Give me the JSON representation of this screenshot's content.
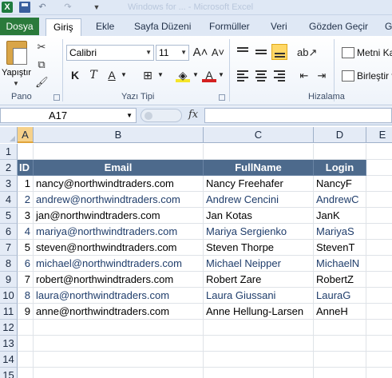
{
  "titlebar": {
    "app_icon": "X",
    "title_text": "Windows for ... - Microsoft Excel"
  },
  "tabs": [
    {
      "label": "Dosya",
      "kind": "file"
    },
    {
      "label": "Giriş",
      "kind": "active"
    },
    {
      "label": "Ekle"
    },
    {
      "label": "Sayfa Düzeni"
    },
    {
      "label": "Formüller"
    },
    {
      "label": "Veri"
    },
    {
      "label": "Gözden Geçir"
    },
    {
      "label": "G"
    }
  ],
  "ribbon": {
    "clipboard": {
      "paste_label": "Yapıştır",
      "group_label": "Pano"
    },
    "font": {
      "font_name": "Calibri",
      "font_size": "11",
      "bold": "K",
      "italic": "T",
      "underline": "A",
      "group_label": "Yazı Tipi"
    },
    "alignment": {
      "wrap_text": "Metni Ka",
      "merge": "Birleştir v",
      "group_label": "Hizalama"
    }
  },
  "formula_bar": {
    "name_box": "A17",
    "fx": "fx",
    "formula": ""
  },
  "sheet": {
    "columns": [
      "A",
      "B",
      "C",
      "D",
      "E"
    ],
    "selected_column": "A",
    "row_numbers": [
      "1",
      "2",
      "3",
      "4",
      "5",
      "6",
      "7",
      "8",
      "9",
      "10",
      "11",
      "12",
      "13",
      "14",
      "15"
    ],
    "header": [
      "ID",
      "Email",
      "FullName",
      "Login"
    ],
    "rows": [
      {
        "id": "1",
        "email": "nancy@northwindtraders.com",
        "fullname": "Nancy Freehafer",
        "login": "NancyF"
      },
      {
        "id": "2",
        "email": "andrew@northwindtraders.com",
        "fullname": "Andrew Cencini",
        "login": "AndrewC"
      },
      {
        "id": "3",
        "email": "jan@northwindtraders.com",
        "fullname": "Jan Kotas",
        "login": "JanK"
      },
      {
        "id": "4",
        "email": "mariya@northwindtraders.com",
        "fullname": "Mariya Sergienko",
        "login": "MariyaS"
      },
      {
        "id": "5",
        "email": "steven@northwindtraders.com",
        "fullname": "Steven Thorpe",
        "login": "StevenT"
      },
      {
        "id": "6",
        "email": "michael@northwindtraders.com",
        "fullname": "Michael Neipper",
        "login": "MichaelN"
      },
      {
        "id": "7",
        "email": "robert@northwindtraders.com",
        "fullname": "Robert Zare",
        "login": "RobertZ"
      },
      {
        "id": "8",
        "email": "laura@northwindtraders.com",
        "fullname": "Laura Giussani",
        "login": "LauraG"
      },
      {
        "id": "9",
        "email": "anne@northwindtraders.com",
        "fullname": "Anne Hellung-Larsen",
        "login": "AnneH"
      }
    ]
  },
  "colors": {
    "header_fill": "#4d6a8c",
    "banded_text": "#1f3d6b",
    "file_tab": "#2a7a3b"
  }
}
